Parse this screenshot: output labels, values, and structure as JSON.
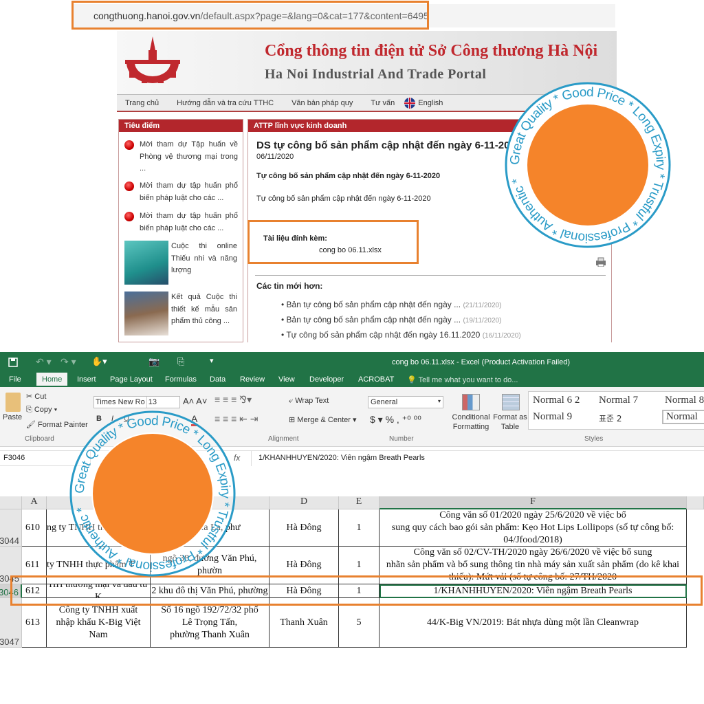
{
  "browser": {
    "url_host": "congthuong.hanoi.gov.vn",
    "url_path": "/default.aspx?page=&lang=0&cat=177&content=6495"
  },
  "site": {
    "title": "Cổng thông tin điện tử Sở Công thương Hà Nội",
    "subtitle": "Ha Noi Industrial And Trade Portal",
    "nav": [
      "Trang chủ",
      "Hướng dẫn và tra cứu TTHC",
      "Văn bản pháp quy",
      "Tư vấn",
      "English"
    ],
    "sidebar": {
      "header": "Tiêu điểm",
      "items": [
        {
          "text": "Mời tham dự Tập huấn về Phòng vệ thương mại trong ..."
        },
        {
          "text": "Mời tham dự tập huấn phổ biến pháp luật cho các ..."
        },
        {
          "text": "Mời tham dự tập huấn phổ biến pháp luật cho các ..."
        },
        {
          "text": "Cuộc thi online Thiếu nhi và năng lượng"
        },
        {
          "text": "Kết quả Cuộc thi thiết kế mẫu sản phẩm thủ công ..."
        }
      ]
    },
    "article": {
      "category": "ATTP lĩnh vực kinh doanh",
      "title": "DS tự công bố sản phẩm cập nhật đến ngày 6-11-2020",
      "date": "06/11/2020",
      "lead": "Tự công bố sản phẩm cập nhật đến ngày 6-11-2020",
      "body": "Tự công bố sản phẩm cập nhật đến ngày 6-11-2020",
      "attachment_label": "Tài liệu đính kèm:",
      "attachment_file": "cong bo 06.11.xlsx",
      "newer_header": "Các tin mới hơn:",
      "newer": [
        {
          "title": "Bản tự công bố sản phẩm cập nhật đến ngày ...",
          "date": "(21/11/2020)"
        },
        {
          "title": "Bản tự công bố sản phẩm cập nhật đến ngày ...",
          "date": "(19/11/2020)"
        },
        {
          "title": "Tự công bố sản phẩm cập nhật đến ngày 16.11.2020",
          "date": "(16/11/2020)"
        }
      ]
    }
  },
  "excel": {
    "title": "cong bo 06.11.xlsx - Excel (Product Activation Failed)",
    "tabs": [
      "File",
      "Home",
      "Insert",
      "Page Layout",
      "Formulas",
      "Data",
      "Review",
      "View",
      "Developer",
      "ACROBAT"
    ],
    "tell_me": "Tell me what you want to do...",
    "ribbon": {
      "paste": "Paste",
      "cut": "Cut",
      "copy": "Copy",
      "format_painter": "Format Painter",
      "clipboard": "Clipboard",
      "font": "Times New Ro",
      "size": "13",
      "wrap": "Wrap Text",
      "merge": "Merge & Center",
      "alignment": "Alignment",
      "number_format": "General",
      "number": "Number",
      "conditional": "Conditional Formatting",
      "format_table": "Format as Table",
      "styles": "Styles",
      "style_items": [
        "Normal 6 2",
        "Normal 7",
        "Normal 8",
        "Normal 9",
        "표준 2",
        "Normal"
      ]
    },
    "name_box": "F3046",
    "fx": "fx",
    "formula": "1/KHANHHUYEN/2020: Viên ngậm Breath Pearls",
    "columns": [
      "A",
      "D",
      "E",
      "F"
    ],
    "rows": [
      {
        "num": "3044",
        "a": "610",
        "b": "ng ty TNHH th",
        "c": "mới Xa La, phư",
        "d": "Hà Đông",
        "e": "1",
        "f": "Công văn số 01/2020 ngày 25/6/2020  về việc bổ\nsung quy cách bao gói sản phẩm: Kẹo Hot Lips Lollipops (số tự công bố:\n04/Jfood/2018)"
      },
      {
        "num": "3045",
        "a": "611",
        "b": "ty TNHH thực phẩm T",
        "c": "ngõ 38, đường Văn Phú, phườn",
        "d": "Hà Đông",
        "e": "1",
        "f": "Công văn số 02/CV-TH/2020 ngày 26/6/2020 về việc bổ sung\nnhãn sản phẩm và bổ sung thông tin nhà máy sản xuất sản phẩm (do kê khai\nthiếu): Mứt vải (số tự công bố: 27/TH/2020"
      },
      {
        "num": "3046",
        "a": "612",
        "b": "HH thương mại và đầu tư K",
        "c": "2 khu đô thị Văn Phú, phường",
        "d": "Hà Đông",
        "e": "1",
        "f": "1/KHANHHUYEN/2020: Viên ngậm Breath Pearls"
      },
      {
        "num": "3047",
        "a": "613",
        "b": "Công ty TNHH xuất\nnhập khẩu K-Big Việt\nNam",
        "c": "Số 16 ngõ 192/72/32 phố\nLê Trọng Tấn,\nphường Thanh Xuân",
        "d": "Thanh Xuân",
        "e": "5",
        "f": "44/K-Big VN/2019: Bát nhựa dùng một lần Cleanwrap"
      }
    ]
  },
  "stamp": {
    "text": "Great Quality * Good Price * Long Expiry * Trustful * Professional * Authentic *",
    "ring_color": "#2a9bc7",
    "fill_color": "#f5842a"
  },
  "colors": {
    "highlight": "#e8812f",
    "excel_green": "#217346",
    "site_red": "#b3262c"
  }
}
